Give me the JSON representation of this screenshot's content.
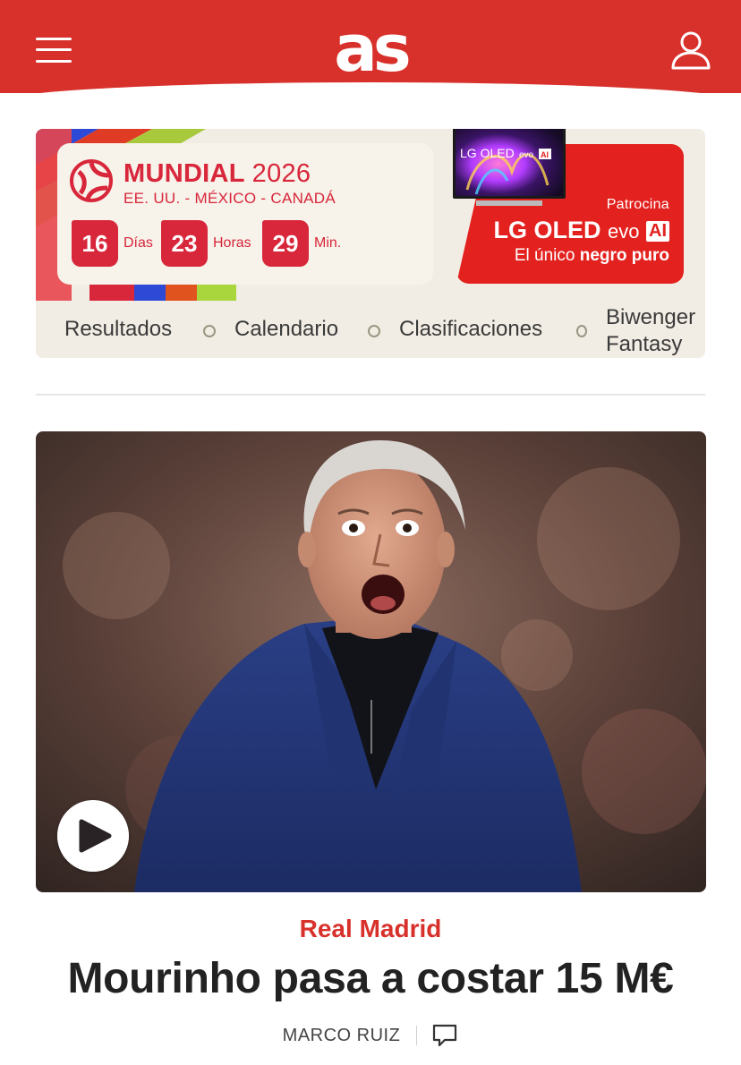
{
  "header": {
    "logo_text": "as",
    "menu_icon": "hamburger-menu-icon",
    "user_icon": "user-icon",
    "brand_color": "#d8312b"
  },
  "mundial": {
    "title": "MUNDIAL",
    "year": "2026",
    "hosts": "EE. UU. - MÉXICO - CANADÁ",
    "countdown": [
      {
        "value": "16",
        "unit": "Días"
      },
      {
        "value": "23",
        "unit": "Horas"
      },
      {
        "value": "29",
        "unit": "Min."
      }
    ],
    "sponsor": {
      "label": "Patrocina",
      "brand": "LG OLED",
      "evo": "evo",
      "ai": "AI",
      "tagline_prefix": "El único",
      "tagline_bold": "negro puro",
      "tv_label": "LG OLED evo AI"
    },
    "nav": [
      "Resultados",
      "Calendario",
      "Clasificaciones",
      "Biwenger",
      "Fantasy"
    ]
  },
  "article": {
    "section": "Real Madrid",
    "headline": "Mourinho pasa a costar 15 M€",
    "author": "MARCO RUIZ",
    "play_icon": "play-icon",
    "comment_icon": "comment-icon"
  }
}
